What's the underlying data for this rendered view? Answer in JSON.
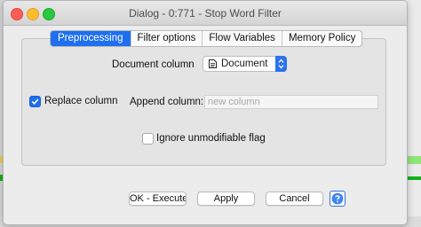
{
  "background": {
    "partial_text": "Preprocessin"
  },
  "window": {
    "title": "Dialog - 0:771 - Stop Word Filter"
  },
  "tabs": [
    {
      "label": "Preprocessing",
      "active": true
    },
    {
      "label": "Filter options",
      "active": false
    },
    {
      "label": "Flow Variables",
      "active": false
    },
    {
      "label": "Memory Policy",
      "active": false
    }
  ],
  "form": {
    "document_column_label": "Document column",
    "document_column_value": "Document",
    "replace_column_label": "Replace column",
    "replace_column_checked": true,
    "append_column_label": "Append column:",
    "append_column_placeholder": "new column",
    "ignore_flag_label": "Ignore unmodifiable flag",
    "ignore_flag_checked": false
  },
  "buttons": {
    "ok_label": "OK - Execute",
    "apply_label": "Apply",
    "cancel_label": "Cancel",
    "help_icon": "question-mark-icon"
  },
  "colors": {
    "accent": "#1f6ff0",
    "close": "#fd5e57",
    "minimize": "#fdbc2e",
    "maximize": "#28c840"
  }
}
